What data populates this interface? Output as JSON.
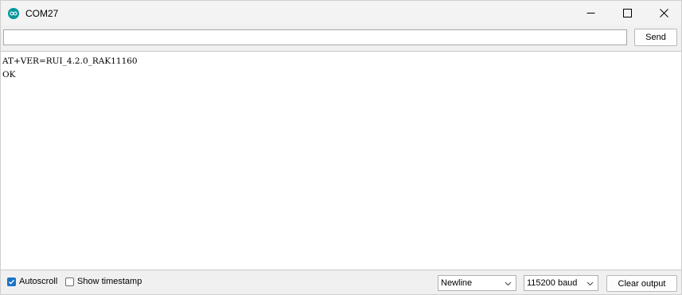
{
  "window": {
    "title": "COM27",
    "app_icon": "arduino-icon",
    "accent": "#00979d",
    "controls": [
      "minimize-icon",
      "maximize-icon",
      "close-icon"
    ]
  },
  "send_bar": {
    "input_value": "",
    "send_label": "Send"
  },
  "output": {
    "lines": [
      "AT+VER=RUI_4.2.0_RAK11160",
      "OK"
    ]
  },
  "bottom_bar": {
    "autoscroll": {
      "label": "Autoscroll",
      "checked": true
    },
    "show_timestamp": {
      "label": "Show timestamp",
      "checked": false
    },
    "line_ending": {
      "selected": "Newline"
    },
    "baud_rate": {
      "selected": "115200 baud"
    },
    "clear_label": "Clear output",
    "checkbox_color": "#1a73c7"
  }
}
